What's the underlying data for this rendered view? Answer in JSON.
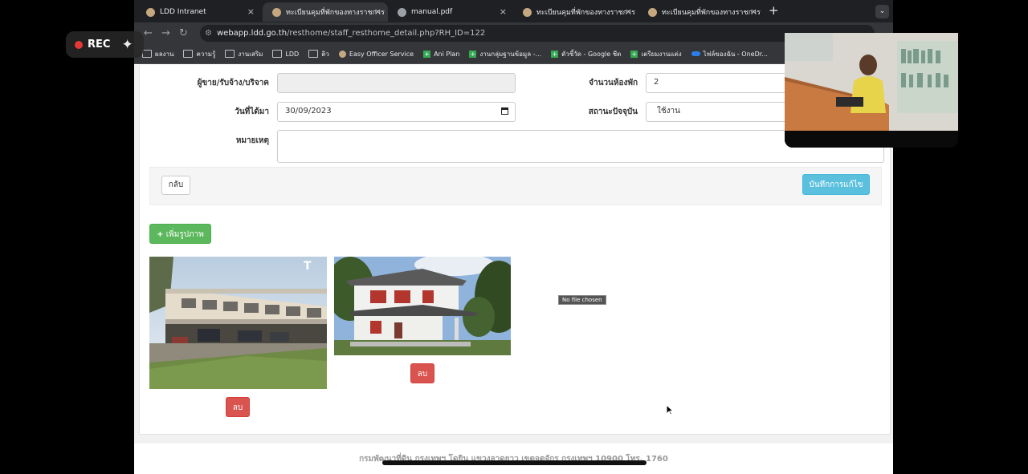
{
  "browser": {
    "tabs": [
      {
        "title": "LDD Intranet",
        "favicon": "site-logo-icon",
        "active": false
      },
      {
        "title": "ทะเบียนคุมที่พักของทางราชการ",
        "favicon": "site-logo-icon",
        "active": true
      },
      {
        "title": "manual.pdf",
        "favicon": "globe-icon",
        "active": false
      },
      {
        "title": "ทะเบียนคุมที่พักของทางราชการ",
        "favicon": "site-logo-icon",
        "active": false
      },
      {
        "title": "ทะเบียนคุมที่พักของทางราชการ",
        "favicon": "site-logo-icon",
        "active": false
      }
    ],
    "url_host": "webapp.ldd.go.th",
    "url_path": "/resthome/staff_resthome_detail.php?RH_ID=122",
    "bookmarks": [
      {
        "label": "ผลงาน",
        "icon": "folder-icon"
      },
      {
        "label": "ความรู้",
        "icon": "folder-icon"
      },
      {
        "label": "งานเสริม",
        "icon": "folder-icon"
      },
      {
        "label": "LDD",
        "icon": "folder-icon"
      },
      {
        "label": "ติว",
        "icon": "folder-icon"
      },
      {
        "label": "Easy Officer Service",
        "icon": "site-logo-icon"
      },
      {
        "label": "Ani Plan",
        "icon": "sheets-icon"
      },
      {
        "label": "งานกลุ่มฐานข้อมูล -...",
        "icon": "sheets-icon"
      },
      {
        "label": "ตัวชี้วัด - Google ชีต",
        "icon": "sheets-icon"
      },
      {
        "label": "เตรียมงานแต่ง",
        "icon": "sheets-icon"
      },
      {
        "label": "ไฟล์ของฉัน - OneDr...",
        "icon": "onedrive-icon"
      }
    ]
  },
  "recording": {
    "label": "REC"
  },
  "form": {
    "seller_label": "ผู้ขาย/รับจ้าง/บริจาค",
    "seller_value": "",
    "rooms_label": "จำนวนห้องพัก",
    "rooms_value": "2",
    "date_label": "วันที่ได้มา",
    "date_value": "30/09/2023",
    "status_label": "สถานะปัจจุบัน",
    "status_value": "ใช้งาน",
    "note_label": "หมายเหตุ",
    "note_value": ""
  },
  "actions": {
    "back_label": "กลับ",
    "save_label": "บันทึกการแก้ไข",
    "add_image_label": "เพิ่มรูปภาพ"
  },
  "images": [
    {
      "delete_label": "ลบ",
      "watermark": "T"
    },
    {
      "delete_label": "ลบ"
    }
  ],
  "tooltip": "No file chosen",
  "footer": "กรมพัฒนาที่ดิน กรุงเทพฯ โดยิน แขวงลาดยาว เขตจตุจักร กรุงเทพฯ 10900 โทร. 1760",
  "colors": {
    "save": "#5bc0de",
    "add": "#5cb85c",
    "delete": "#d9534f"
  }
}
